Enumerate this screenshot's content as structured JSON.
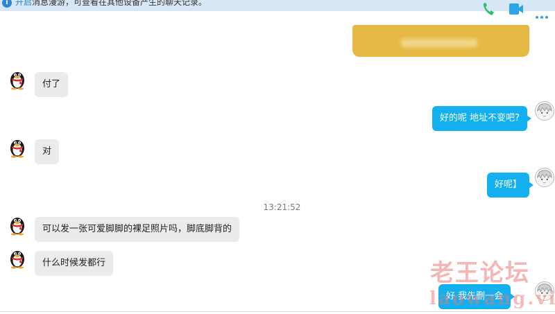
{
  "notice": {
    "link": "开启",
    "text": "消息漫游，可查看在其他设备产生的聊天记录。"
  },
  "toolbar": [
    "phone-icon",
    "video-icon",
    "more-icon"
  ],
  "messages": [
    {
      "side": "in",
      "text": "付了"
    },
    {
      "side": "out",
      "text": "好的呢 地址不变吧?"
    },
    {
      "side": "in",
      "text": "对"
    },
    {
      "side": "out",
      "text": "好呢】"
    },
    {
      "side": "in",
      "text": "可以发一张可爱脚脚的裸足照片吗，脚底脚背的"
    },
    {
      "side": "in",
      "text": "什么时候发都行"
    },
    {
      "side": "out",
      "text": "好 我先删一会"
    }
  ],
  "timestamp": "13:21:52",
  "watermark": {
    "line1": "老王论坛",
    "line2": "laowang.vip"
  },
  "colors": {
    "outgoing_bubble": "#13b0ef",
    "incoming_bubble": "#ebebeb",
    "notice_bar": "#d7e7f5",
    "card": "#e5b944"
  }
}
